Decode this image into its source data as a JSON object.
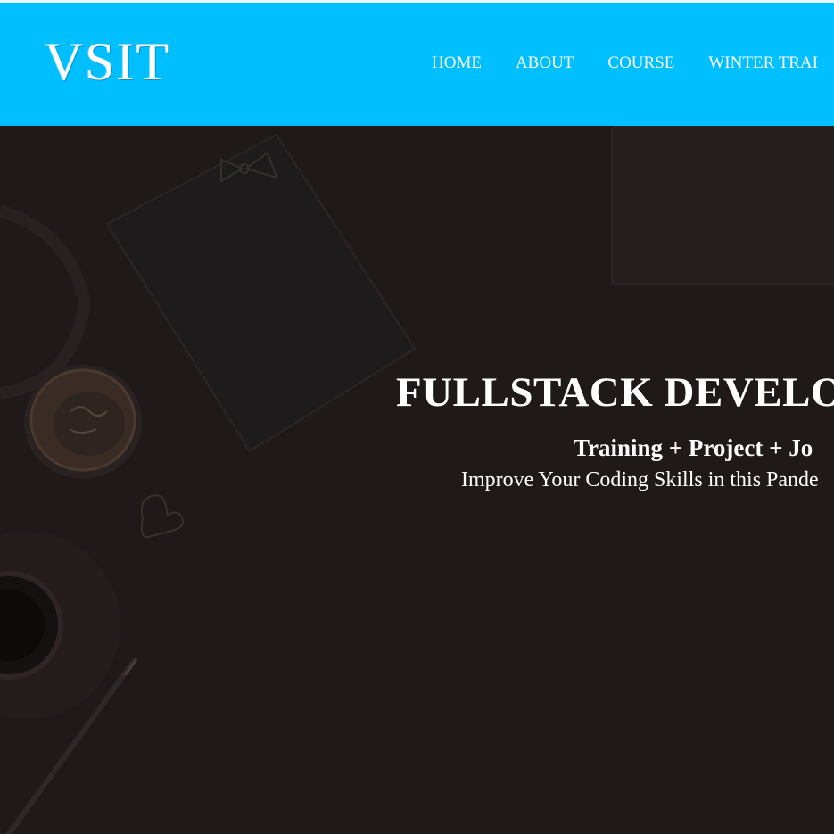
{
  "header": {
    "logo_text": "VSIT",
    "nav_items": [
      {
        "label": "HOME"
      },
      {
        "label": "ABOUT"
      },
      {
        "label": "COURSE"
      },
      {
        "label": "WINTER TRAI"
      }
    ]
  },
  "hero": {
    "title": "FULLSTACK DEVELO",
    "subtitle": "Training + Project + Jo",
    "tagline": "Improve Your Coding Skills in this Pande",
    "background_description_icons": [
      "notebook-icon",
      "bowtie-icon",
      "coin-jar-icon",
      "coffee-cup-icon",
      "pen-icon",
      "tablet-icon",
      "paper-clip-icon"
    ]
  },
  "colors": {
    "navbar": "#00bfff",
    "hero_overlay": "#1f1919",
    "text": "#ffffff"
  }
}
